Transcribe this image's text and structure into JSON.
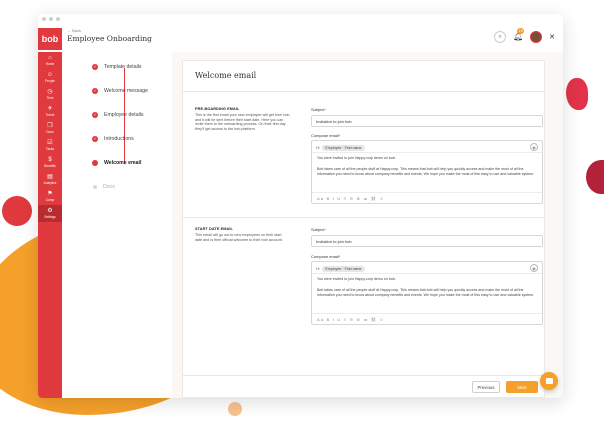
{
  "app": {
    "logo": "bob",
    "back_label": "← Back",
    "page_title": "Employee Onboarding",
    "notif_count": "19"
  },
  "sidebar": {
    "items": [
      {
        "icon": "⌂",
        "label": "Home"
      },
      {
        "icon": "☺",
        "label": "People"
      },
      {
        "icon": "◷",
        "label": "Time"
      },
      {
        "icon": "✈",
        "label": "Travel"
      },
      {
        "icon": "❐",
        "label": "Docs"
      },
      {
        "icon": "☑",
        "label": "Tasks"
      },
      {
        "icon": "$",
        "label": "Benefits"
      },
      {
        "icon": "▤",
        "label": "Analytics"
      },
      {
        "icon": "⚑",
        "label": "Comp"
      },
      {
        "icon": "⚙",
        "label": "Settings"
      }
    ]
  },
  "steps": [
    {
      "label": "Template details",
      "state": "done"
    },
    {
      "label": "Welcome message",
      "state": "done"
    },
    {
      "label": "Employee details",
      "state": "done"
    },
    {
      "label": "Introductions",
      "state": "done"
    },
    {
      "label": "Welcome email",
      "state": "current"
    },
    {
      "label": "Docs",
      "state": "pending"
    }
  ],
  "panel": {
    "title": "Welcome email"
  },
  "preboarding": {
    "title": "PRE-BOARDING EMAIL",
    "description": "This is the first email your new employee will get from bob, and it will be sent before their start date. Here you can invite them to the onboarding process. On their first day they'll get access to the bob platform.",
    "subject_label": "Subject",
    "subject_value": "Invitation to join bob",
    "compose_label": "Compose email",
    "to_prefix": "Hi",
    "to_chip": "Employee · First name",
    "para1": "You were invited to join Happy.corp demo on bob.",
    "para2": "Bob takes care of all the people stuff at Happy.corp. This means that bob will help you quickly access and make the most of all the information you need to know about company benefits and events. We hope you make the most of this easy to use and valuable system."
  },
  "startdate": {
    "title": "START DATE EMAIL",
    "description": "This email will go out to new employees on their start date and is their official welcome to their bob account.",
    "subject_label": "Subject",
    "subject_value": "Invitation to join bob",
    "compose_label": "Compose email",
    "to_prefix": "Hi",
    "to_chip": "Employee · First name",
    "para1": "You were invited to join Happy.corp demo on bob.",
    "para2": "Bob takes care of all the people stuff at Happy.corp. This means that bob will help you quickly access and make the most of all the information you need to know about company benefits and events. We hope you make the most of this easy to use and valuable system."
  },
  "toolbar": {
    "glyphs": "Aa B I U ≡ ⊖ ⊜ ≔ ⛓ ☺"
  },
  "footer": {
    "previous_label": "Previous",
    "next_label": "Next"
  },
  "colors": {
    "brand_red": "#e0393e",
    "accent_orange": "#f5a02a"
  }
}
